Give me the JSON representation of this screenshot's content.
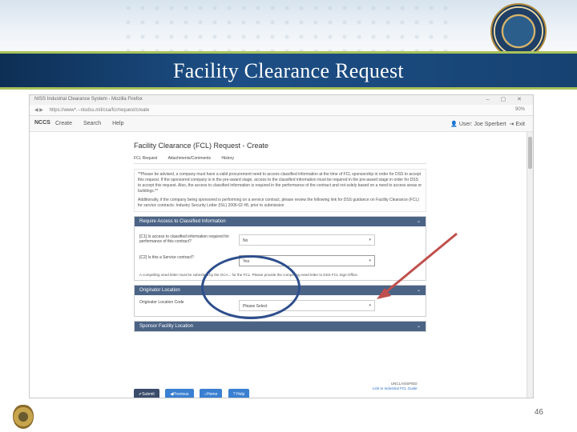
{
  "slide": {
    "title": "Facility Clearance Request",
    "page_number": "46"
  },
  "browser": {
    "window_title": "NISS Industrial Clearance System - Mozilla Firefox",
    "url": "https://www*.--nisdss.mil/csa/fcr/request/create",
    "zoom": "90%"
  },
  "app_nav": {
    "brand": "NCCS",
    "menu": [
      "Create",
      "Search",
      "Help"
    ],
    "user": "User: Joe Sperbert",
    "logout": "Exit"
  },
  "page": {
    "title": "Facility Clearance (FCL) Request - Create",
    "tabs": [
      "FCL Request",
      "Attachments/Comments",
      "History"
    ],
    "notice_1": "**Please be advised, a company must have a valid procurement need to access classified information at the time of FCL sponsorship in order for DSS to accept this request. If the sponsored company is in the pre-award stage, access to the classified information must be required in the pre-award stage in order for DSS to accept this request. Also, the access to classified information is required in the performance of the contract and not solely based on a need to access areas or buildings.**",
    "notice_2": "Additionally, if the company being sponsored is performing on a service contract, please review the following link for DSS guidance on Facility Clearance (FCL) for service contracts: Industry Security Letter (ISL) 2006-02 #8, prior to submission"
  },
  "panels": {
    "classified": {
      "header": "Require Access to Classified Information",
      "q1_label": "[C1] Is access to classified information required for performance of this contract?",
      "q1_value": "No",
      "q2_label": "[C2] Is this a Service contract?",
      "q2_value": "Yes",
      "help": "A compelling need letter must be submitted by the GCA... for the FCL. Please provide the compelling need letter to DSS FCL Sign-Office."
    },
    "originator": {
      "header": "Originator Location",
      "field_label": "Originator Location Code",
      "field_value": "Please Select"
    },
    "sponsor": {
      "header": "Sponsor Facility Location"
    }
  },
  "buttons": {
    "submit": "Submit",
    "previous": "Previous",
    "home": "Home",
    "help": "Help"
  },
  "footer": {
    "classification": "UNCLASSIFIED",
    "link": "Link to Industrial FCL Guide"
  },
  "icons": {
    "submit": "check-icon",
    "previous": "arrow-left-icon",
    "home": "home-icon",
    "help": "question-icon",
    "user": "user-icon",
    "logout": "logout-icon"
  },
  "colors": {
    "title_band": "#1d4f86",
    "title_border": "#a8c25a",
    "panel_header": "#4b6486",
    "annotation_circle": "#2e4f8d",
    "annotation_arrow": "#c0504d"
  }
}
